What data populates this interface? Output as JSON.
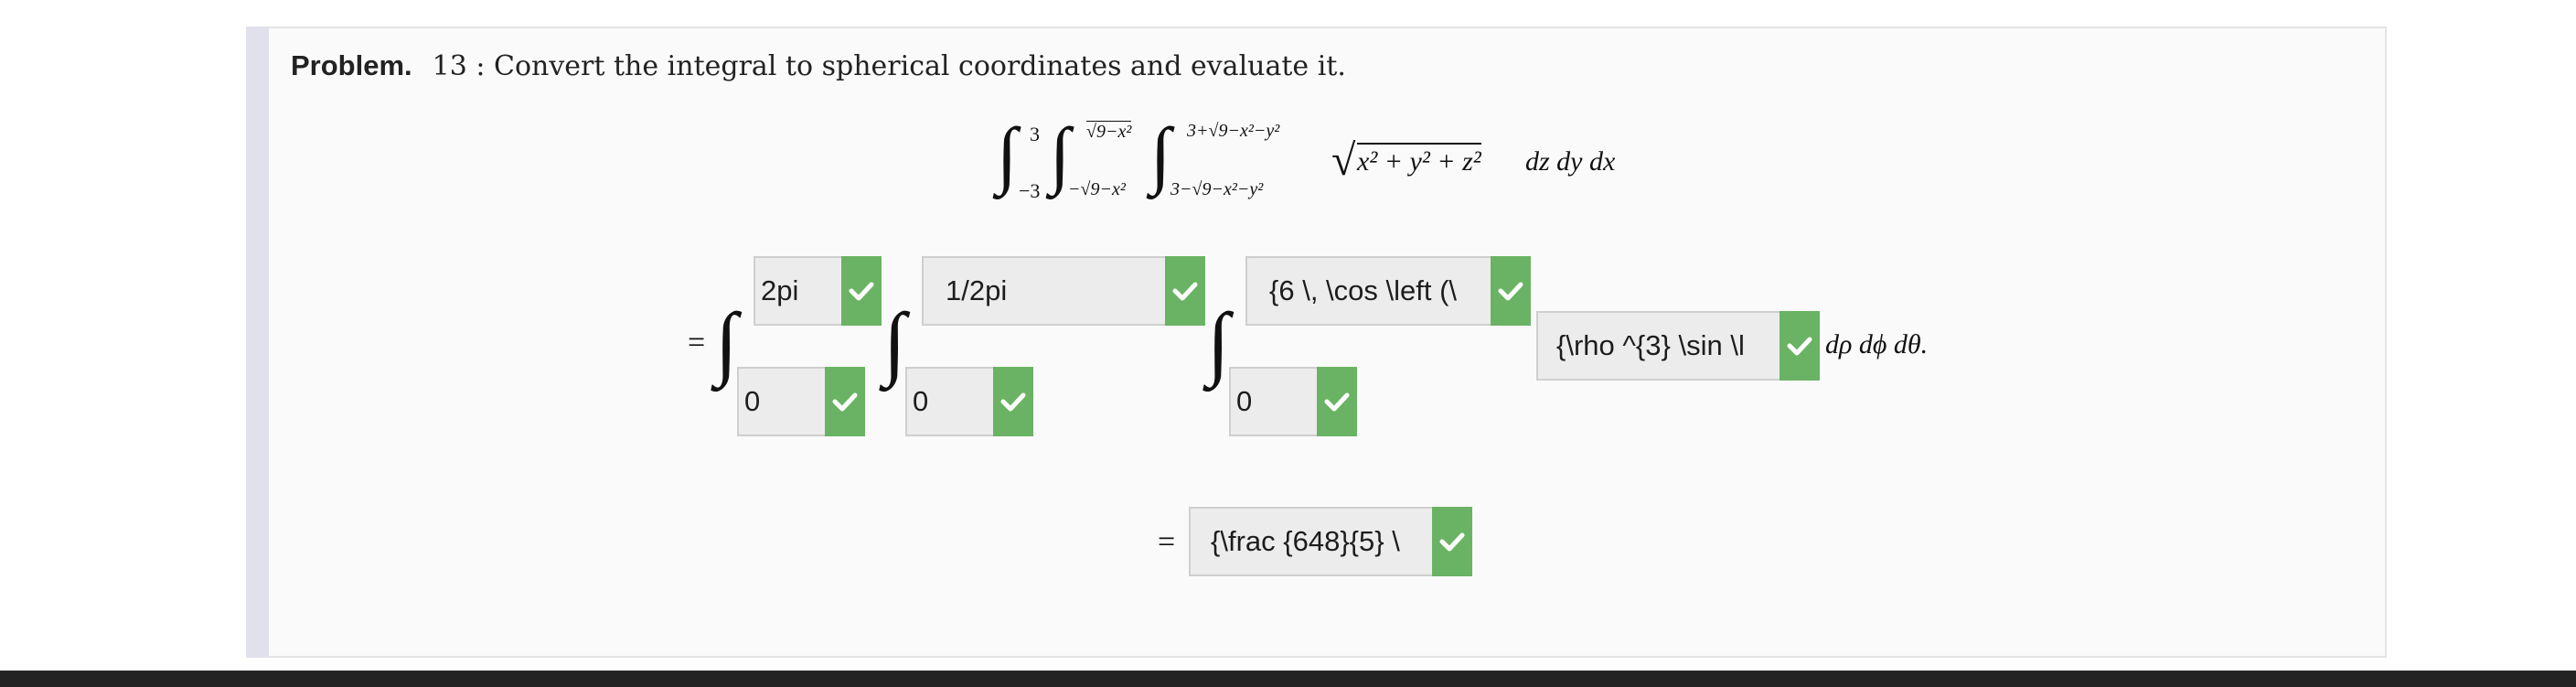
{
  "problem": {
    "label": "Problem.",
    "text": "13 : Convert the integral to spherical coordinates and evaluate it."
  },
  "given_integral": {
    "outer_lower": "−3",
    "outer_upper": "3",
    "middle_lower": "−√9−x²",
    "middle_upper": "√9−x²",
    "inner_lower": "3−√9−x²−y²",
    "inner_upper": "3+√9−x²−y²",
    "integrand": "x² + y² + z²",
    "differentials": "dz dy dx"
  },
  "spherical": {
    "equals": "=",
    "differentials": "dρ dϕ dθ."
  },
  "answers": {
    "theta_upper": "2pi",
    "theta_lower": "0",
    "phi_upper": "1/2pi",
    "phi_lower": "0",
    "rho_upper": "{6 \\, \\cos \\left (\\",
    "rho_lower": "0",
    "integrand": "{\\rho ^{3} \\sin \\l",
    "result": "{\\frac {648}{5} \\"
  },
  "result_equals": "=",
  "colors": {
    "check_green": "#6ab364",
    "field_bg": "#ececed",
    "card_bg": "#fafafa",
    "accent": "#e1e1ec"
  },
  "icons": {
    "check": "checkmark-icon"
  }
}
